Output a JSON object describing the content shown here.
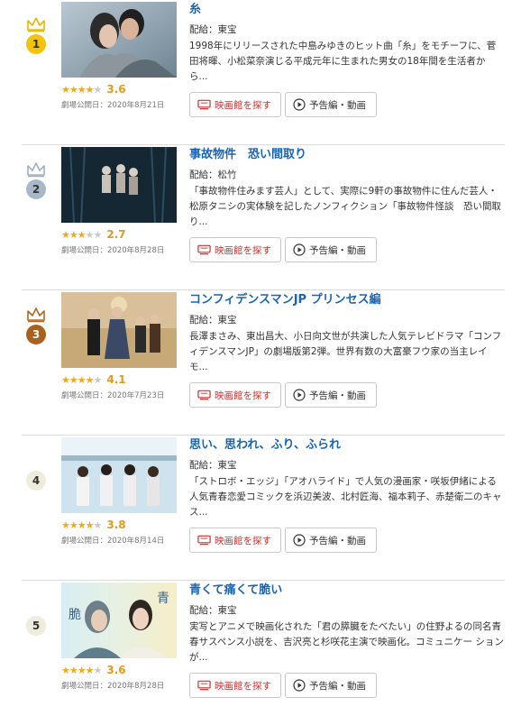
{
  "labels": {
    "dist_prefix": "配給：",
    "release_prefix": "劇場公開日：",
    "theater_button": "映画館を探す",
    "trailer_button": "予告編・動画"
  },
  "colors": {
    "title": "#1a64b4",
    "theater_button": "#d22e2e",
    "star": "#f0a91e",
    "rank1": "#f5c20a",
    "rank2": "#a8b8c8",
    "rank3": "#a8621e"
  },
  "movies": [
    {
      "rank": "1",
      "crown": "gold",
      "title": "糸",
      "distributor": "配給：東宝",
      "description": "1998年にリリースされた中島みゆきのヒット曲「糸」をモチーフに、菅田将暉、小松菜奈演じる平成元年に生まれた男女の18年間を生活者か ら...",
      "rating": "3.6",
      "stars": [
        1,
        1,
        1,
        0.5,
        0
      ],
      "release": "劇場公開日：2020年8月21日"
    },
    {
      "rank": "2",
      "crown": "silver",
      "title": "事故物件　恐い間取り",
      "distributor": "配給：松竹",
      "description": "「事故物件住みます芸人」として、実際に9軒の事故物件に住んだ芸人・松原タニシの実体験を記したノンフィクション「事故物件怪談　恐い間取り...",
      "rating": "2.7",
      "stars": [
        1,
        1,
        0.5,
        0,
        0
      ],
      "release": "劇場公開日：2020年8月28日"
    },
    {
      "rank": "3",
      "crown": "bronze",
      "title": "コンフィデンスマンJP プリンセス編",
      "distributor": "配給：東宝",
      "description": "長澤まさみ、東出昌大、小日向文世が共演した人気テレビドラマ「コンフィデンスマンJP」の劇場版第2弾。世界有数の大富豪フウ家の当主レイ モ...",
      "rating": "4.1",
      "stars": [
        1,
        1,
        1,
        1,
        0
      ],
      "release": "劇場公開日：2020年7月23日"
    },
    {
      "rank": "4",
      "crown": "none",
      "title": "思い、思われ、ふり、ふられ",
      "distributor": "配給：東宝",
      "description": "「ストロボ・エッジ」「アオハライド」で人気の漫画家・咲坂伊緒による人気青春恋愛コミックを浜辺美波、北村匠海、福本莉子、赤楚衛二のキャ ス...",
      "rating": "3.8",
      "stars": [
        1,
        1,
        1,
        1,
        0
      ],
      "release": "劇場公開日：2020年8月14日"
    },
    {
      "rank": "5",
      "crown": "none",
      "title": "青くて痛くて脆い",
      "distributor": "配給：東宝",
      "description": "実写とアニメで映画化された「君の膵臓をたべたい」の住野よるの同名青春サスペンス小説を、吉沢亮と杉咲花主演で映画化。コミュニケー ションが...",
      "rating": "3.6",
      "stars": [
        1,
        1,
        1,
        0.5,
        0
      ],
      "release": "劇場公開日：2020年8月28日"
    }
  ]
}
